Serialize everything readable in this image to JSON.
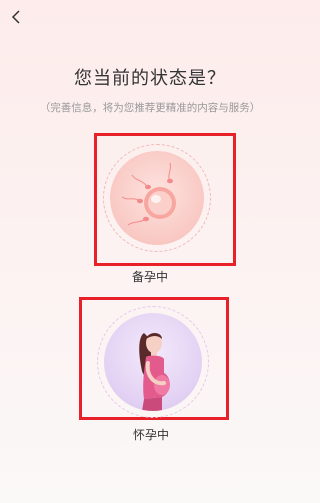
{
  "header": {
    "back_icon": "chevron-left-icon"
  },
  "question": {
    "title": "您当前的状态是？",
    "subtitle": "（完善信息，将为您推荐更精准的内容与服务）"
  },
  "options": [
    {
      "label": "备孕中",
      "icon": "sperm-egg-icon"
    },
    {
      "label": "怀孕中",
      "icon": "pregnant-woman-icon"
    }
  ],
  "colors": {
    "highlight_border": "#e8202a",
    "accent_pink": "#f28b8b",
    "accent_purple": "#c9a7e6"
  }
}
